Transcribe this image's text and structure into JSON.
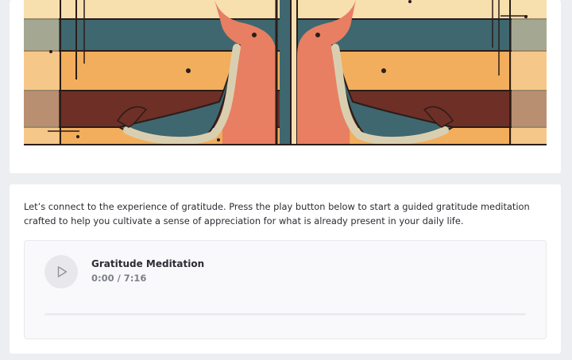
{
  "intro_text": "Let’s connect to the experience of gratitude. Press the play button below to start a guided gratitude meditation crafted to help you cultivate a sense of appreciation for what is already present in your daily life.",
  "player": {
    "title": "Gratitude Meditation",
    "time": "0:00 / 7:16",
    "progress": 0,
    "play_icon": "play-icon"
  },
  "colors": {
    "page_bg": "#edeef1",
    "card_bg": "#ffffff",
    "cream": "#f7dfae",
    "teal": "#3f6770",
    "orange": "#f2ae5c",
    "maroon": "#6e2f27",
    "coral": "#e87f62"
  }
}
